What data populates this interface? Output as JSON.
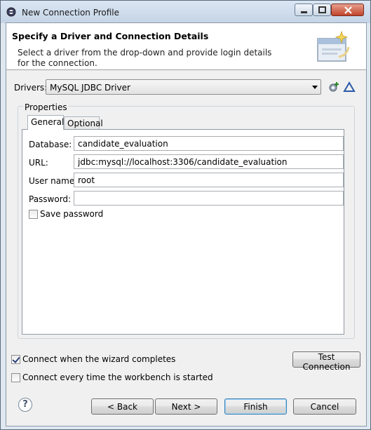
{
  "window": {
    "title": "New Connection Profile"
  },
  "header": {
    "title": "Specify a Driver and Connection Details",
    "description": "Select a driver from the drop-down and provide login details for the connection."
  },
  "drivers": {
    "label": "Drivers:",
    "selected": "MySQL JDBC Driver"
  },
  "properties": {
    "group_label": "Properties",
    "tabs": [
      "General",
      "Optional"
    ],
    "active_tab": "General",
    "fields": {
      "database": {
        "label": "Database:",
        "value": "candidate_evaluation"
      },
      "url": {
        "label": "URL:",
        "value": "jdbc:mysql://localhost:3306/candidate_evaluation"
      },
      "username": {
        "label": "User name:",
        "value": "root"
      },
      "password": {
        "label": "Password:",
        "value": ""
      }
    },
    "save_password": {
      "label": "Save password",
      "checked": false
    }
  },
  "options": {
    "connect_on_finish": {
      "label": "Connect when the wizard completes",
      "checked": true
    },
    "connect_on_startup": {
      "label": "Connect every time the workbench is started",
      "checked": false
    },
    "test_connection_label": "Test Connection"
  },
  "footer": {
    "help_icon": "?",
    "back_label": "< Back",
    "next_label": "Next >",
    "finish_label": "Finish",
    "cancel_label": "Cancel"
  },
  "icons": {
    "app": "eclipse-icon",
    "new_driver": "new-driver-icon",
    "edit_driver": "edit-driver-icon",
    "wizard_banner": "connection-wizard-icon"
  }
}
